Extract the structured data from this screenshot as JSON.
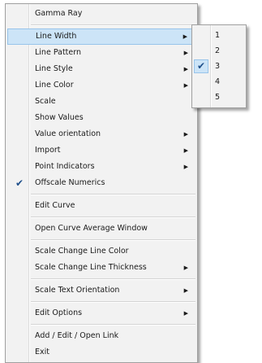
{
  "menu": {
    "groups": [
      [
        {
          "label": "Gamma Ray"
        }
      ],
      [
        {
          "label": "Line Width",
          "submenu": true,
          "highlighted": true
        },
        {
          "label": "Line Pattern",
          "submenu": true
        },
        {
          "label": "Line Style",
          "submenu": true
        },
        {
          "label": "Line Color",
          "submenu": true
        },
        {
          "label": "Scale"
        },
        {
          "label": "Show Values"
        },
        {
          "label": "Value orientation",
          "submenu": true
        },
        {
          "label": "Import",
          "submenu": true
        },
        {
          "label": "Point Indicators",
          "submenu": true
        },
        {
          "label": "Offscale Numerics",
          "checked": true
        }
      ],
      [
        {
          "label": "Edit Curve"
        }
      ],
      [
        {
          "label": "Open Curve Average Window"
        }
      ],
      [
        {
          "label": "Scale Change Line Color"
        },
        {
          "label": "Scale Change Line Thickness",
          "submenu": true
        }
      ],
      [
        {
          "label": "Scale Text Orientation",
          "submenu": true
        }
      ],
      [
        {
          "label": "Edit Options",
          "submenu": true
        }
      ],
      [
        {
          "label": "Add / Edit / Open Link"
        },
        {
          "label": "Exit"
        }
      ]
    ]
  },
  "submenu": {
    "items": [
      {
        "label": "1"
      },
      {
        "label": "2"
      },
      {
        "label": "3",
        "checked": true
      },
      {
        "label": "4"
      },
      {
        "label": "5"
      }
    ]
  },
  "icons": {
    "arrow": "submenu-arrow-icon",
    "check": "checkmark-icon"
  }
}
